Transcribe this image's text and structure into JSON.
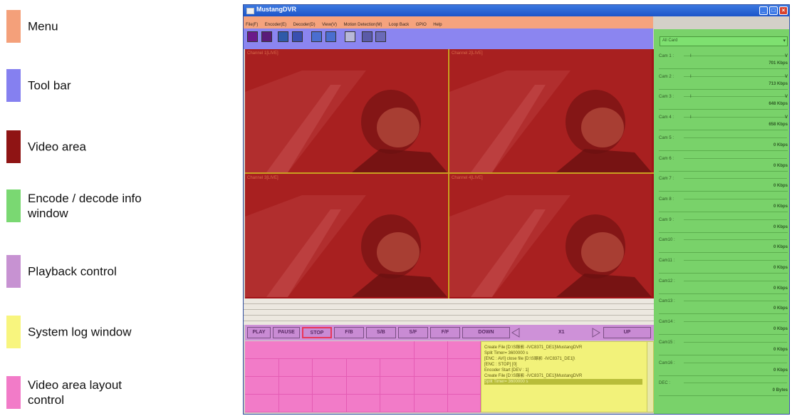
{
  "legend": [
    {
      "label": "Menu",
      "color": "#f4a07a"
    },
    {
      "label": "Tool bar",
      "color": "#8580f0"
    },
    {
      "label": "Video area",
      "color": "#8f1414"
    },
    {
      "label": "Encode / decode info\nwindow",
      "color": "#7ad872"
    },
    {
      "label": "Playback control",
      "color": "#c792d2"
    },
    {
      "label": "System log window",
      "color": "#f8f57e"
    },
    {
      "label": "Video area layout\ncontrol",
      "color": "#f27bc8"
    }
  ],
  "window": {
    "title": "MustangDVR",
    "menu": [
      "File(F)",
      "Encoder(E)",
      "Decoder(D)",
      "View(V)",
      "Motion Detection(M)",
      "Loop Back",
      "GPIO",
      "Help"
    ]
  },
  "video": {
    "channels": [
      "Channel 1[LIVE]",
      "Channel 2[LIVE]",
      "Channel 3[LIVE]",
      "Channel 4[LIVE]"
    ]
  },
  "playback": {
    "buttons": [
      "PLAY",
      "PAUSE",
      "STOP",
      "F/B",
      "S/B",
      "S/F",
      "F/F"
    ],
    "down": "DOWN",
    "speed": "X1",
    "up": "UP"
  },
  "log": {
    "lines": [
      "Create File [D:\\S錄影 -IVC8371_DE1]\\MustangDVR",
      "Split Timer= 3600000 s",
      "[ENC : AVI] close file [D:\\S錄影 -IVC8371_DE1]\\",
      "[ENC : STOP] [0]",
      "Encoder Start [DEV : 1]",
      "Create File [D:\\S錄影 -IVC8371_DE1]\\MustangDVR",
      "Split Timer= 3600000 s"
    ]
  },
  "info": {
    "card_select": "All Card",
    "cams": [
      {
        "label": "Cam 1 :",
        "tick": "I",
        "v": "V",
        "rate": "701 Kbps"
      },
      {
        "label": "Cam 2 :",
        "tick": "I",
        "v": "V",
        "rate": "713 Kbps"
      },
      {
        "label": "Cam 3 :",
        "tick": "I",
        "v": "V",
        "rate": "648 Kbps"
      },
      {
        "label": "Cam 4 :",
        "tick": "I",
        "v": "V",
        "rate": "658 Kbps"
      },
      {
        "label": "Cam 5 :",
        "tick": "",
        "v": "",
        "rate": "0 Kbps"
      },
      {
        "label": "Cam 6 :",
        "tick": "",
        "v": "",
        "rate": "0 Kbps"
      },
      {
        "label": "Cam 7 :",
        "tick": "",
        "v": "",
        "rate": "0 Kbps"
      },
      {
        "label": "Cam 8 :",
        "tick": "",
        "v": "",
        "rate": "0 Kbps"
      },
      {
        "label": "Cam 9 :",
        "tick": "",
        "v": "",
        "rate": "0 Kbps"
      },
      {
        "label": "Cam10 :",
        "tick": "",
        "v": "",
        "rate": "0 Kbps"
      },
      {
        "label": "Cam11 :",
        "tick": "",
        "v": "",
        "rate": "0 Kbps"
      },
      {
        "label": "Cam12 :",
        "tick": "",
        "v": "",
        "rate": "0 Kbps"
      },
      {
        "label": "Cam13 :",
        "tick": "",
        "v": "",
        "rate": "0 Kbps"
      },
      {
        "label": "Cam14 :",
        "tick": "",
        "v": "",
        "rate": "0 Kbps"
      },
      {
        "label": "Cam15 :",
        "tick": "",
        "v": "",
        "rate": "0 Kbps"
      },
      {
        "label": "Cam16 :",
        "tick": "",
        "v": "",
        "rate": "0 Kbps"
      },
      {
        "label": "DEC :",
        "tick": "",
        "v": "",
        "rate": "0 Bytes"
      }
    ]
  }
}
